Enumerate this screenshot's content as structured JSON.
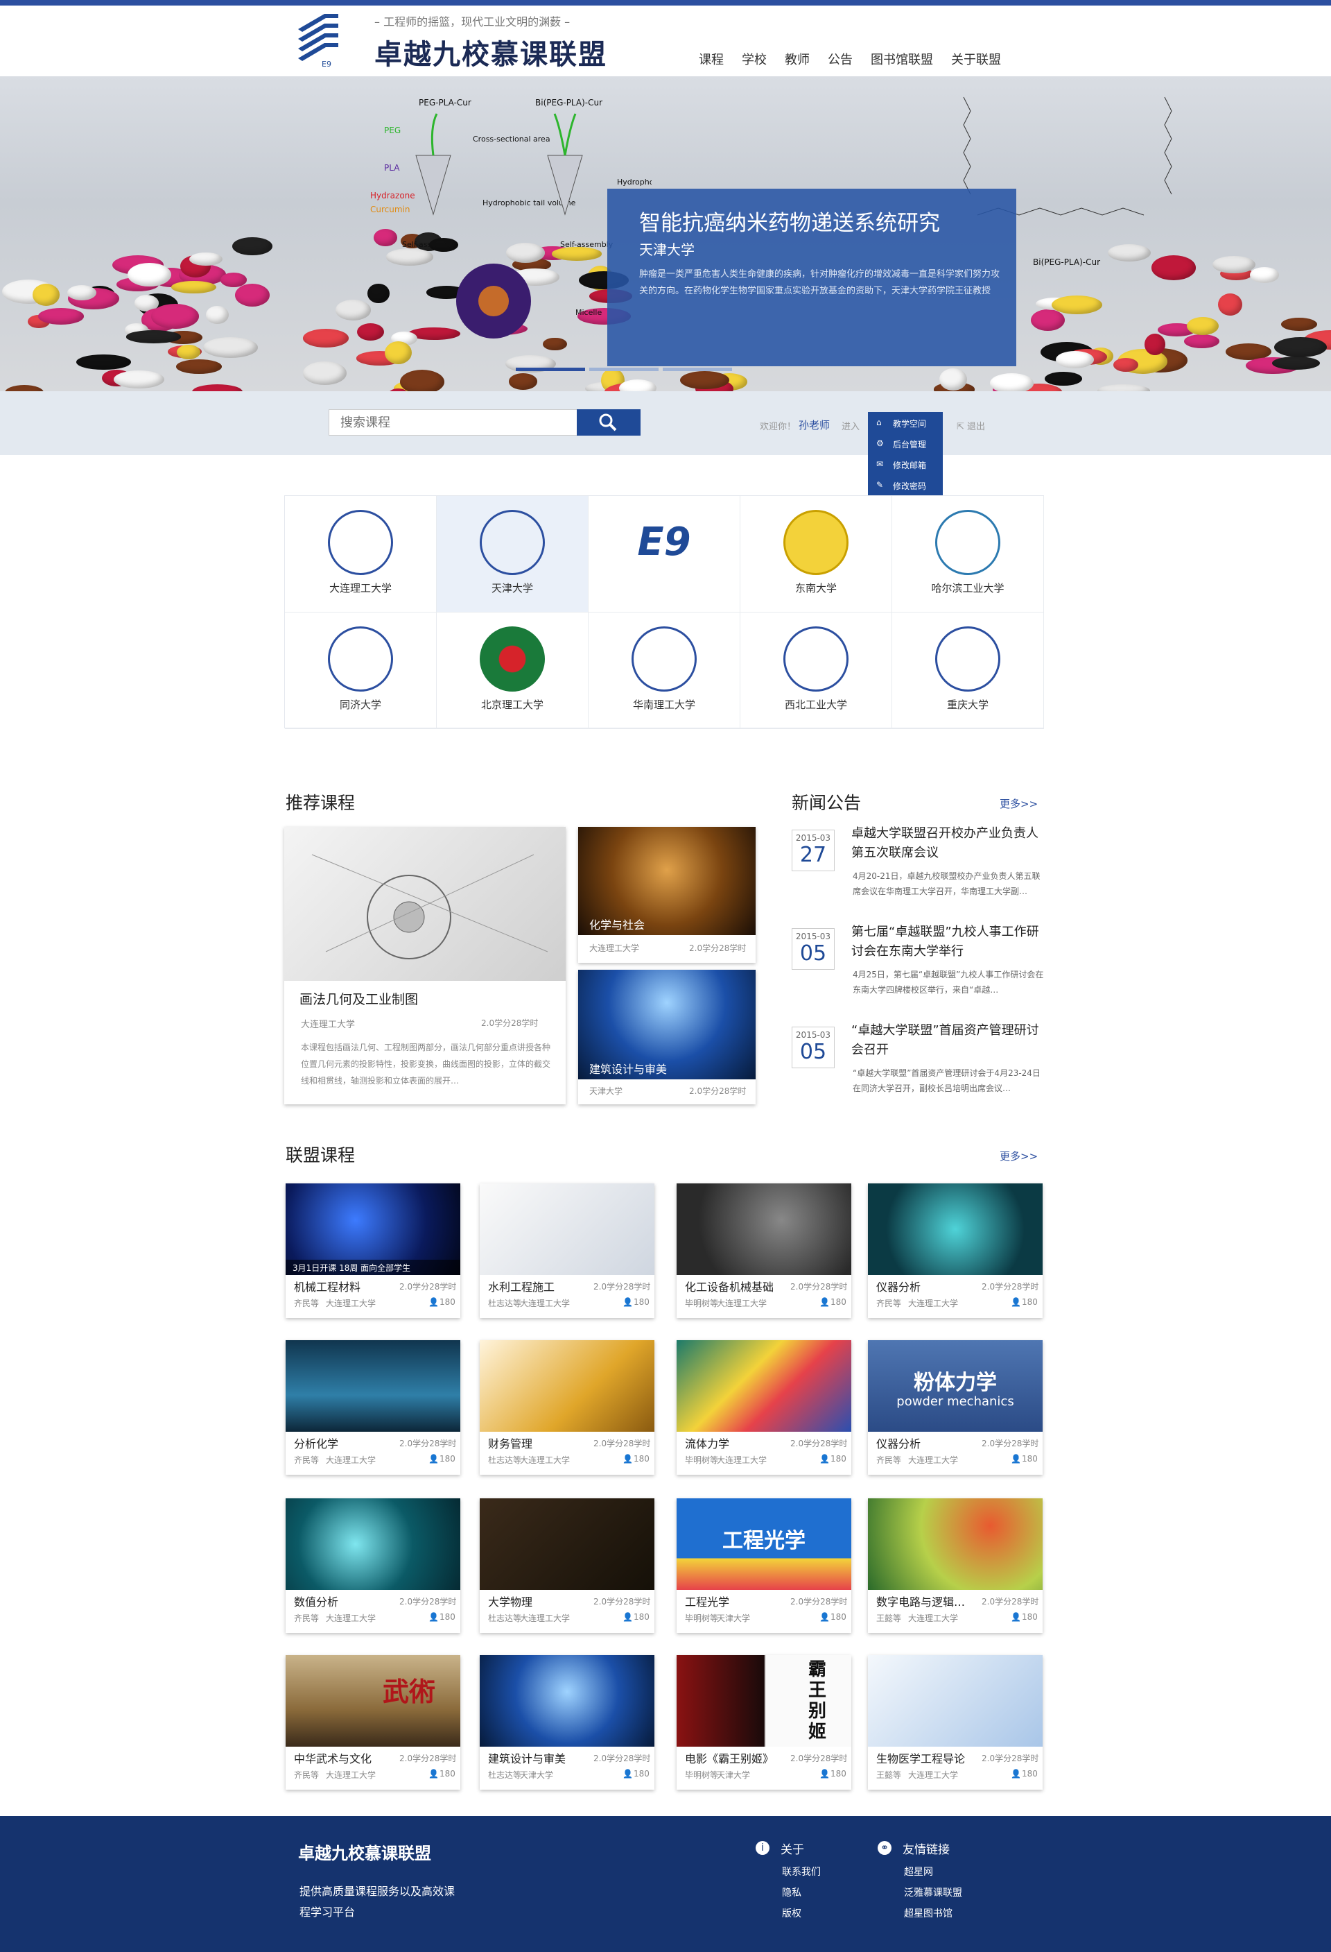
{
  "header": {
    "tagline": "– 工程师的摇篮，现代工业文明的渊薮 –",
    "title": "卓越九校慕课联盟",
    "logo_text": "E9",
    "nav": [
      "课程",
      "学校",
      "教师",
      "公告",
      "图书馆联盟",
      "关于联盟"
    ]
  },
  "banner": {
    "title": "智能抗癌纳米药物递送系统研究",
    "subtitle": "天津大学",
    "description": "肿瘤是一类严重危害人类生命健康的疾病，针对肿瘤化疗的增效减毒一直是科学家们努力攻关的方向。在药物化学生物学国家重点实验开放基金的资助下，天津大学药学院王征教授",
    "diagram_labels": [
      "PEG-PLA-Cur",
      "Bi(PEG-PLA)-Cur",
      "PEG",
      "PLA",
      "Hydrazone",
      "Curcumin",
      "Cross-sectional area",
      "Hydrophobic tail length",
      "Hydrophobic tail volume",
      "Self-assembly",
      "Self-assembly",
      "Micelle",
      "Bi(PEG-PLA)-Cur"
    ],
    "slides": 3,
    "active_slide": 1
  },
  "search": {
    "placeholder": "搜索课程",
    "welcome": "欢迎你！",
    "user": "孙老师",
    "enter": "进入",
    "logout": "退出",
    "menu": [
      "教学空间",
      "后台管理",
      "修改邮箱",
      "修改密码"
    ]
  },
  "schools": [
    {
      "name": "大连理工大学",
      "highlight": false
    },
    {
      "name": "天津大学",
      "highlight": true
    },
    {
      "name": "E9",
      "highlight": false
    },
    {
      "name": "东南大学",
      "highlight": false
    },
    {
      "name": "哈尔滨工业大学",
      "highlight": false
    },
    {
      "name": "同济大学",
      "highlight": false
    },
    {
      "name": "北京理工大学",
      "highlight": false
    },
    {
      "name": "华南理工大学",
      "highlight": false
    },
    {
      "name": "西北工业大学",
      "highlight": false
    },
    {
      "name": "重庆大学",
      "highlight": false
    }
  ],
  "recommended": {
    "title": "推荐课程",
    "main": {
      "title": "画法几何及工业制图",
      "school": "大连理工大学",
      "credits": "2.0学分28学时",
      "description": "本课程包括画法几何、工程制图两部分，画法几何部分重点讲授各种位置几何元素的投影特性，投影变换，曲线面图的投影，立体的截交线和相贯线，轴测投影和立体表面的展开…"
    },
    "side": [
      {
        "title": "化学与社会",
        "school": "大连理工大学",
        "credits": "2.0学分28学时"
      },
      {
        "title": "建筑设计与审美",
        "school": "天津大学",
        "credits": "2.0学分28学时"
      }
    ]
  },
  "news": {
    "title": "新闻公告",
    "more": "更多>>",
    "items": [
      {
        "ym": "2015-03",
        "day": "27",
        "title": "卓越大学联盟召开校办产业负责人第五次联席会议",
        "summary": "4月20-21日，卓越九校联盟校办产业负责人第五联席会议在华南理工大学召开，华南理工大学副…"
      },
      {
        "ym": "2015-03",
        "day": "05",
        "title": "第七届“卓越联盟”九校人事工作研讨会在东南大学举行",
        "summary": "4月25日，第七届“卓越联盟”九校人事工作研讨会在东南大学四牌楼校区举行，来自“卓越…"
      },
      {
        "ym": "2015-03",
        "day": "05",
        "title": "“卓越大学联盟”首届资产管理研讨会召开",
        "summary": "“卓越大学联盟”首届资产管理研讨会于4月23-24日在同济大学召开，副校长吕培明出席会议…"
      }
    ]
  },
  "alliance": {
    "title": "联盟课程",
    "more": "更多>>",
    "courses": [
      {
        "title": "机械工程材料",
        "teacher": "齐民等",
        "school": "大连理工大学",
        "credits": "2.0学分28学时",
        "count": "180",
        "note": "3月1日开课 18周 面向全部学生"
      },
      {
        "title": "水利工程施工",
        "teacher": "杜志达等",
        "school": "大连理工大学",
        "credits": "2.0学分28学时",
        "count": "180"
      },
      {
        "title": "化工设备机械基础",
        "teacher": "毕明树等",
        "school": "大连理工大学",
        "credits": "2.0学分28学时",
        "count": "180"
      },
      {
        "title": "仪器分析",
        "teacher": "齐民等",
        "school": "大连理工大学",
        "credits": "2.0学分28学时",
        "count": "180"
      },
      {
        "title": "分析化学",
        "teacher": "齐民等",
        "school": "大连理工大学",
        "credits": "2.0学分28学时",
        "count": "180"
      },
      {
        "title": "财务管理",
        "teacher": "杜志达等",
        "school": "大连理工大学",
        "credits": "2.0学分28学时",
        "count": "180"
      },
      {
        "title": "流体力学",
        "teacher": "毕明树等",
        "school": "大连理工大学",
        "credits": "2.0学分28学时",
        "count": "180"
      },
      {
        "title": "仪器分析",
        "teacher": "齐民等",
        "school": "大连理工大学",
        "credits": "2.0学分28学时",
        "count": "180",
        "overlay": "粉体力学",
        "overlay2": "powder mechanics"
      },
      {
        "title": "数值分析",
        "teacher": "齐民等",
        "school": "大连理工大学",
        "credits": "2.0学分28学时",
        "count": "180"
      },
      {
        "title": "大学物理",
        "teacher": "杜志达等",
        "school": "大连理工大学",
        "credits": "2.0学分28学时",
        "count": "180"
      },
      {
        "title": "工程光学",
        "teacher": "毕明树等",
        "school": "天津大学",
        "credits": "2.0学分28学时",
        "count": "180",
        "overlay": "工程光学"
      },
      {
        "title": "数字电路与逻辑…",
        "teacher": "王懿等",
        "school": "大连理工大学",
        "credits": "2.0学分28学时",
        "count": "180"
      },
      {
        "title": "中华武术与文化",
        "teacher": "齐民等",
        "school": "大连理工大学",
        "credits": "2.0学分28学时",
        "count": "180",
        "overlay": "武術"
      },
      {
        "title": "建筑设计与审美",
        "teacher": "杜志达等",
        "school": "天津大学",
        "credits": "2.0学分28学时",
        "count": "180"
      },
      {
        "title": "电影《霸王别姬》",
        "teacher": "毕明树等",
        "school": "天津大学",
        "credits": "2.0学分28学时",
        "count": "180",
        "overlay": "霸王别姬"
      },
      {
        "title": "生物医学工程导论",
        "teacher": "王懿等",
        "school": "大连理工大学",
        "credits": "2.0学分28学时",
        "count": "180"
      }
    ]
  },
  "footer": {
    "name": "卓越九校慕课联盟",
    "desc": "提供高质量课程服务以及高效课程学习平台",
    "about_title": "关于",
    "about_links": [
      "联系我们",
      "隐私",
      "版权"
    ],
    "links_title": "友情链接",
    "links": [
      "超星网",
      "泛雅慕课联盟",
      "超星图书馆"
    ]
  },
  "colors": {
    "brand": "#1f4a97",
    "footer": "#15336e",
    "accent": "#2c4fa0"
  },
  "icons": [
    "search-icon",
    "home-icon",
    "gear-icon",
    "mail-icon",
    "wrench-icon",
    "logout-icon",
    "user-icon",
    "info-icon",
    "link-icon"
  ]
}
